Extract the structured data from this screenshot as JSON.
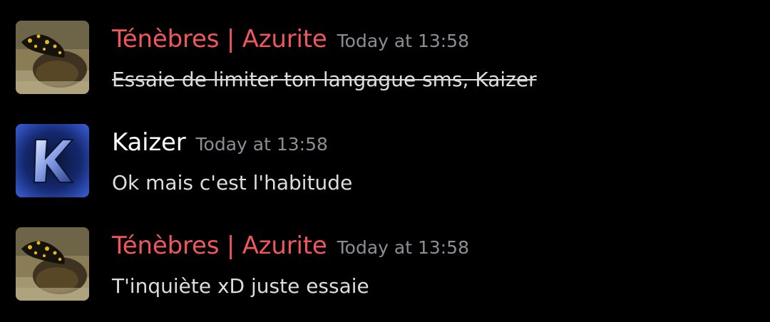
{
  "messages": [
    {
      "author": "Ténèbres | Azurite",
      "author_color": "#f0575d",
      "timestamp": "Today at 13:58",
      "content": "Essaie de limiter ton langague sms, Kaizer",
      "strikethrough": true,
      "avatar": "salamander-avatar"
    },
    {
      "author": "Kaizer",
      "author_color": "#ffffff",
      "timestamp": "Today at 13:58",
      "content": "Ok mais c'est l'habitude",
      "strikethrough": false,
      "avatar": "k-letter-avatar"
    },
    {
      "author": "Ténèbres | Azurite",
      "author_color": "#f0575d",
      "timestamp": "Today at 13:58",
      "content": "T'inquiète xD juste essaie",
      "strikethrough": false,
      "avatar": "salamander-avatar"
    }
  ],
  "colors": {
    "background": "#000000",
    "timestamp": "#8b8e94",
    "message_text": "#dcddde"
  }
}
